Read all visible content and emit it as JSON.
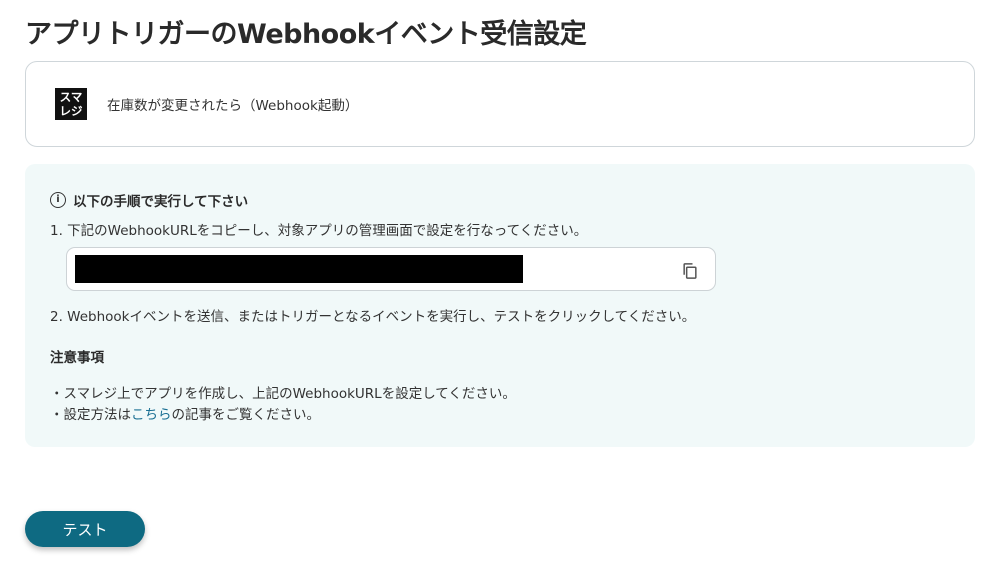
{
  "page": {
    "title": "アプリトリガーのWebhookイベント受信設定"
  },
  "trigger": {
    "app_logo_line1": "スマ",
    "app_logo_line2": "レジ",
    "label": "在庫数が変更されたら（Webhook起動）"
  },
  "instructions": {
    "heading": "以下の手順で実行して下さい",
    "info_icon_glyph": "i",
    "step1": "1. 下記のWebhookURLをコピーし、対象アプリの管理画面で設定を行なってください。",
    "step2": "2. Webhookイベントを送信、またはトリガーとなるイベントを実行し、テストをクリックしてください。",
    "notes_heading": "注意事項",
    "note1": "・スマレジ上でアプリを作成し、上記のWebhookURLを設定してください。",
    "note2_prefix": "・設定方法は",
    "note2_link": "こちら",
    "note2_suffix": "の記事をご覧ください。"
  },
  "icons": {
    "copy": "copy-icon",
    "info": "info-icon"
  },
  "colors": {
    "panel_bg": "#f1f9f9",
    "primary": "#0e6a82",
    "link": "#1a6f93"
  },
  "actions": {
    "test_label": "テスト"
  }
}
